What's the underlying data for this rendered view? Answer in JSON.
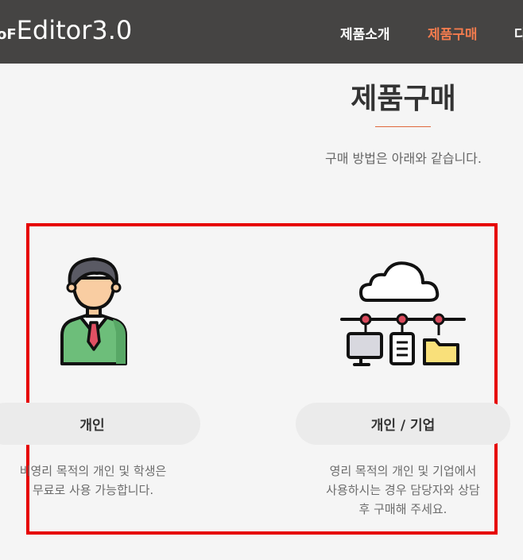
{
  "header": {
    "logo_prefix": "oF",
    "logo_text": "Editor3.0",
    "nav": [
      {
        "label": "제품소개"
      },
      {
        "label": "제품구매"
      },
      {
        "label": "다"
      }
    ]
  },
  "main": {
    "title": "제품구매",
    "subtitle": "구매 방법은 아래와 같습니다.",
    "options": [
      {
        "label": "개인",
        "icon": "person-icon",
        "description": [
          "비영리 목적의 개인 및 학생은",
          "무료로 사용 가능합니다."
        ]
      },
      {
        "label": "개인 / 기업",
        "icon": "cloud-network-icon",
        "description": [
          "영리 목적의 개인 및 기업에서",
          "사용하시는 경우 담당자와 상담",
          "후 구매해 주세요."
        ]
      }
    ]
  },
  "colors": {
    "header_bg": "#454443",
    "accent": "#f27b4e",
    "highlight_border": "#e60000",
    "background": "#f5f5f5"
  }
}
